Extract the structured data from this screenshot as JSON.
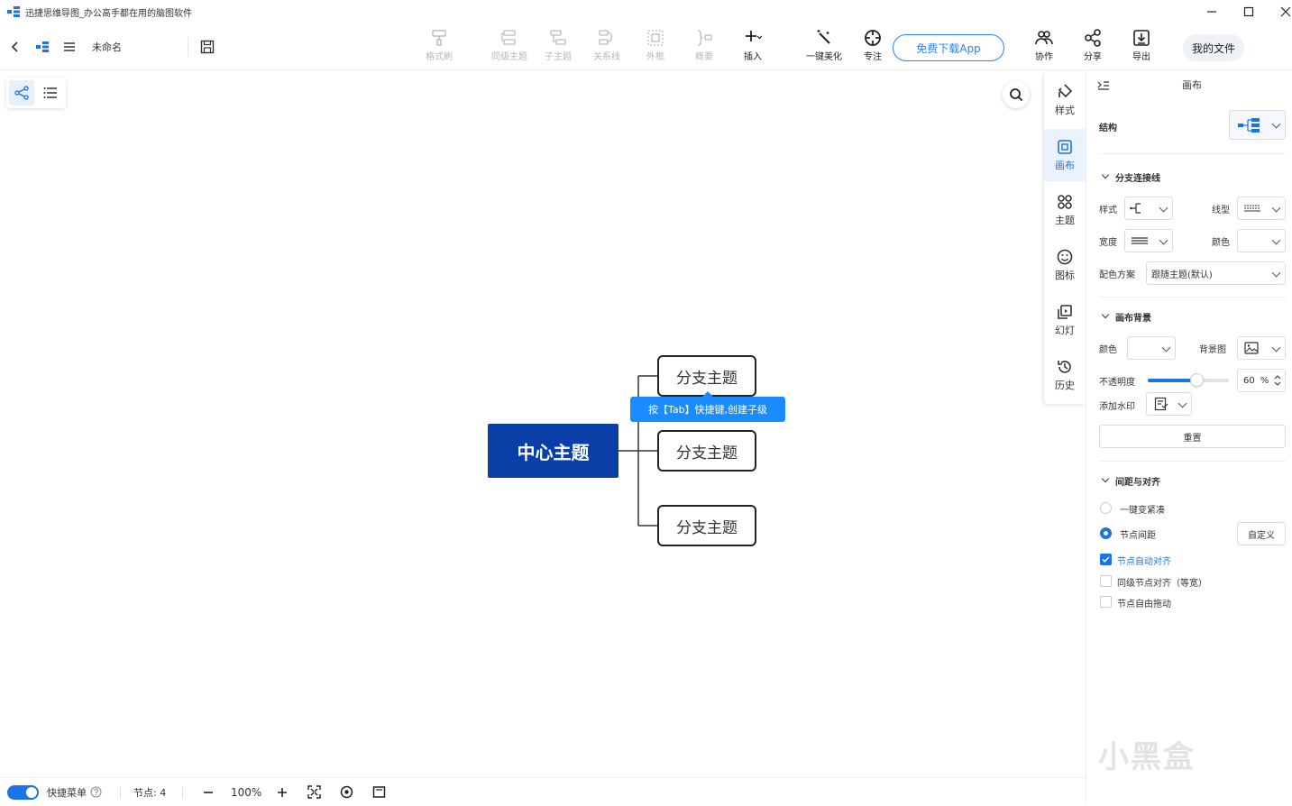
{
  "window": {
    "title": "迅捷思维导图_办公高手都在用的脑图软件"
  },
  "toolbar": {
    "doc_name": "未命名",
    "tools": [
      {
        "label": "格式刷",
        "icon": "format-brush-icon"
      },
      {
        "label": "同级主题",
        "icon": "sibling-topic-icon"
      },
      {
        "label": "子主题",
        "icon": "subtopic-icon"
      },
      {
        "label": "关系线",
        "icon": "relation-line-icon"
      },
      {
        "label": "外框",
        "icon": "boundary-icon"
      },
      {
        "label": "概要",
        "icon": "summary-icon"
      },
      {
        "label": "插入",
        "icon": "insert-icon"
      },
      {
        "label": "一键美化",
        "icon": "magic-wand-icon"
      },
      {
        "label": "专注",
        "icon": "focus-icon"
      }
    ],
    "download_app": "免费下载App",
    "right_tools": [
      {
        "label": "协作",
        "icon": "collaborate-icon"
      },
      {
        "label": "分享",
        "icon": "share-icon"
      },
      {
        "label": "导出",
        "icon": "export-icon"
      }
    ],
    "my_files": "我的文件"
  },
  "mindmap": {
    "central": "中心主题",
    "branches": [
      "分支主题",
      "分支主题",
      "分支主题"
    ],
    "tooltip": "按【Tab】快捷键,创建子级"
  },
  "side_tabs": [
    {
      "label": "样式",
      "icon": "style-icon"
    },
    {
      "label": "画布",
      "icon": "canvas-icon"
    },
    {
      "label": "主题",
      "icon": "theme-icon"
    },
    {
      "label": "图标",
      "icon": "emoji-icon"
    },
    {
      "label": "幻灯",
      "icon": "slides-icon"
    },
    {
      "label": "历史",
      "icon": "history-icon"
    }
  ],
  "panel": {
    "title": "画布",
    "structure_label": "结构",
    "branch_section": "分支连接线",
    "style_label": "样式",
    "line_type_label": "线型",
    "width_label": "宽度",
    "color_label": "颜色",
    "scheme_label": "配色方案",
    "scheme_value": "跟随主题(默认)",
    "bg_section": "画布背景",
    "bg_color_label": "颜色",
    "bg_image_label": "背景图",
    "opacity_label": "不透明度",
    "opacity_value": "60",
    "opacity_unit": "%",
    "watermark_label": "添加水印",
    "reset": "重置",
    "spacing_section": "间距与对齐",
    "compact": "一键变紧凑",
    "node_spacing": "节点间距",
    "custom": "自定义",
    "auto_align": "节点自动对齐",
    "same_level_align": "同级节点对齐（等宽）",
    "free_drag": "节点自由拖动"
  },
  "statusbar": {
    "quick_menu": "快捷菜单",
    "nodes": "节点: 4",
    "zoom": "100%"
  },
  "watermark": "小黑盒"
}
